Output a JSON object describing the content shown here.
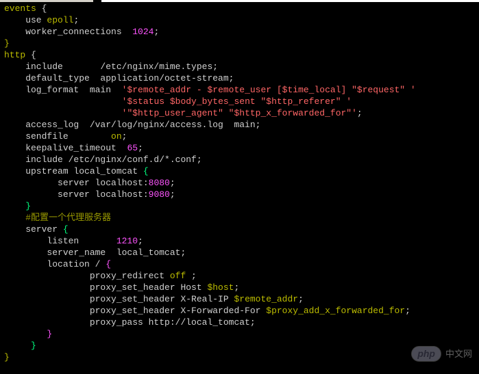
{
  "code": {
    "l1a": "events",
    "l1b": " {",
    "l2a": "    use ",
    "l2b": "epoll",
    "l2c": ";",
    "l3a": "    worker_connections  ",
    "l3b": "1024",
    "l3c": ";",
    "l4": "}",
    "l5a": "http",
    "l5b": " {",
    "l6a": "    include       /etc/nginx/mime.types;",
    "l7a": "    default_type  application/octet-stream;",
    "l8a": "    log_format  main  ",
    "l8b": "'$remote_addr - $remote_user [$time_local] \"$request\" '",
    "l9a": "                      ",
    "l9b": "'$status $body_bytes_sent \"$http_referer\" '",
    "l10a": "                      ",
    "l10b": "'\"$http_user_agent\" \"$http_x_forwarded_for\"'",
    "l10c": ";",
    "l11a": "    access_log  /var/log/nginx/access.log  main;",
    "l12a": "    sendfile        ",
    "l12b": "on",
    "l12c": ";",
    "l13a": "    keepalive_timeout  ",
    "l13b": "65",
    "l13c": ";",
    "l14": "    include /etc/nginx/conf.d/*.conf;",
    "l15a": "    upstream local_tomcat ",
    "l15b": "{",
    "l16a": "          server localhost:",
    "l16b": "8080",
    "l16c": ";",
    "l17a": "          server localhost:",
    "l17b": "9080",
    "l17c": ";",
    "l18": "    }",
    "l19": "    #配置一个代理服务器",
    "l20a": "    server ",
    "l20b": "{",
    "l21a": "        listen       ",
    "l21b": "1210",
    "l21c": ";",
    "l22": "        server_name  local_tomcat;",
    "l23a": "        location / ",
    "l23b": "{",
    "l24a": "                proxy_redirect ",
    "l24b": "off",
    "l24c": " ;",
    "l25a": "                proxy_set_header Host ",
    "l25b": "$host",
    "l25c": ";",
    "l26a": "                proxy_set_header X-Real-IP ",
    "l26b": "$remote_addr",
    "l26c": ";",
    "l27a": "                proxy_set_header X-Forwarded-For ",
    "l27b": "$proxy_add_x_forwarded_for",
    "l27c": ";",
    "l28": "                proxy_pass http://local_tomcat;",
    "l29": "        }",
    "l30": "     }",
    "l31": "}"
  },
  "watermark": {
    "badge": "php",
    "text": "中文网"
  }
}
